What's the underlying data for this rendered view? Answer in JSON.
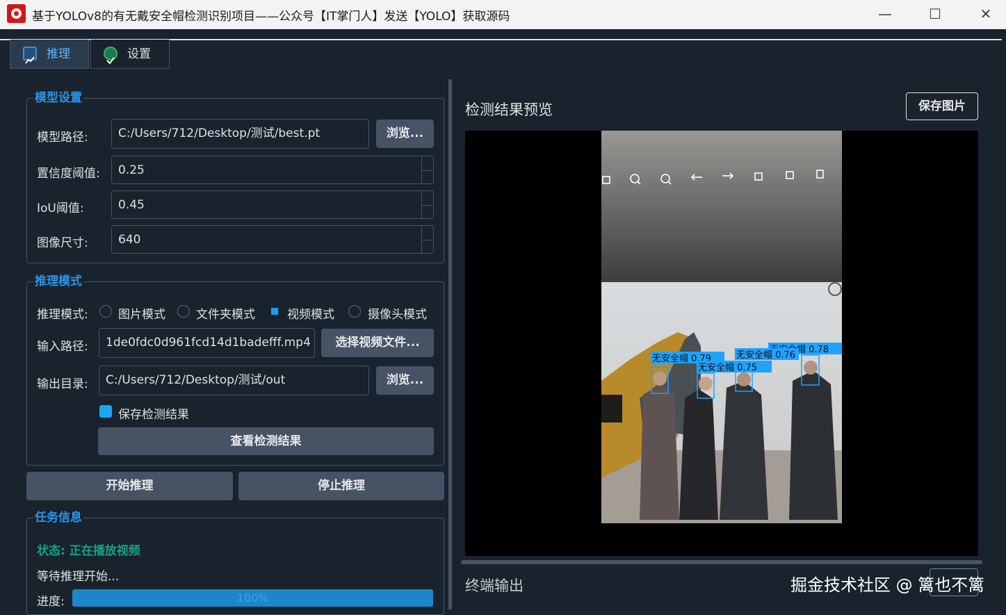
{
  "window": {
    "title": "基于YOLOv8的有无戴安全帽检测识别项目——公众号【IT掌门人】发送【YOLO】获取源码",
    "minimize": "—",
    "maximize": "☐",
    "close": "✕"
  },
  "tabs": [
    {
      "label": "推理",
      "icon": "chart-icon",
      "active": true
    },
    {
      "label": "设置",
      "icon": "check-circle-icon",
      "active": false
    }
  ],
  "model_settings": {
    "title": "模型设置",
    "model_path_label": "模型路径:",
    "model_path_value": "C:/Users/712/Desktop/测试/best.pt",
    "browse_label": "浏览...",
    "conf_label": "置信度阈值:",
    "conf_value": "0.25",
    "iou_label": "IoU阈值:",
    "iou_value": "0.45",
    "imgsz_label": "图像尺寸:",
    "imgsz_value": "640"
  },
  "inference_mode": {
    "title": "推理模式",
    "mode_label": "推理模式:",
    "options": [
      "图片模式",
      "文件夹模式",
      "视频模式",
      "摄像头模式"
    ],
    "selected": "视频模式",
    "input_label": "输入路径:",
    "input_value": "1de0fdc0d961fcd14d1badefff.mp4",
    "select_video_label": "选择视频文件...",
    "output_label": "输出目录:",
    "output_value": "C:/Users/712/Desktop/测试/out",
    "browse_label": "浏览...",
    "save_results_label": "保存检测结果",
    "save_results_checked": true,
    "view_results_label": "查看检测结果"
  },
  "actions": {
    "start_label": "开始推理",
    "stop_label": "停止推理"
  },
  "task_info": {
    "title": "任务信息",
    "status": "状态: 正在播放视频",
    "message": "等待推理开始...",
    "progress_label": "进度:",
    "progress_text": "100%",
    "progress_value": 1.0
  },
  "preview": {
    "title": "检测结果预览",
    "save_image_label": "保存图片",
    "detections": [
      {
        "label": "无安全帽 0.79"
      },
      {
        "label": "无安全帽 0.75"
      },
      {
        "label": "无安全帽 0.78"
      },
      {
        "label": "无安全帽 0.76"
      }
    ]
  },
  "terminal": {
    "title": "终端输出"
  },
  "watermark": "掘金技术社区 @ 篱也不篱",
  "colors": {
    "background": "#19232d",
    "accent": "#2994e8",
    "border": "#455364",
    "status_green": "#16a085",
    "box_color": "#1fa3ff"
  }
}
